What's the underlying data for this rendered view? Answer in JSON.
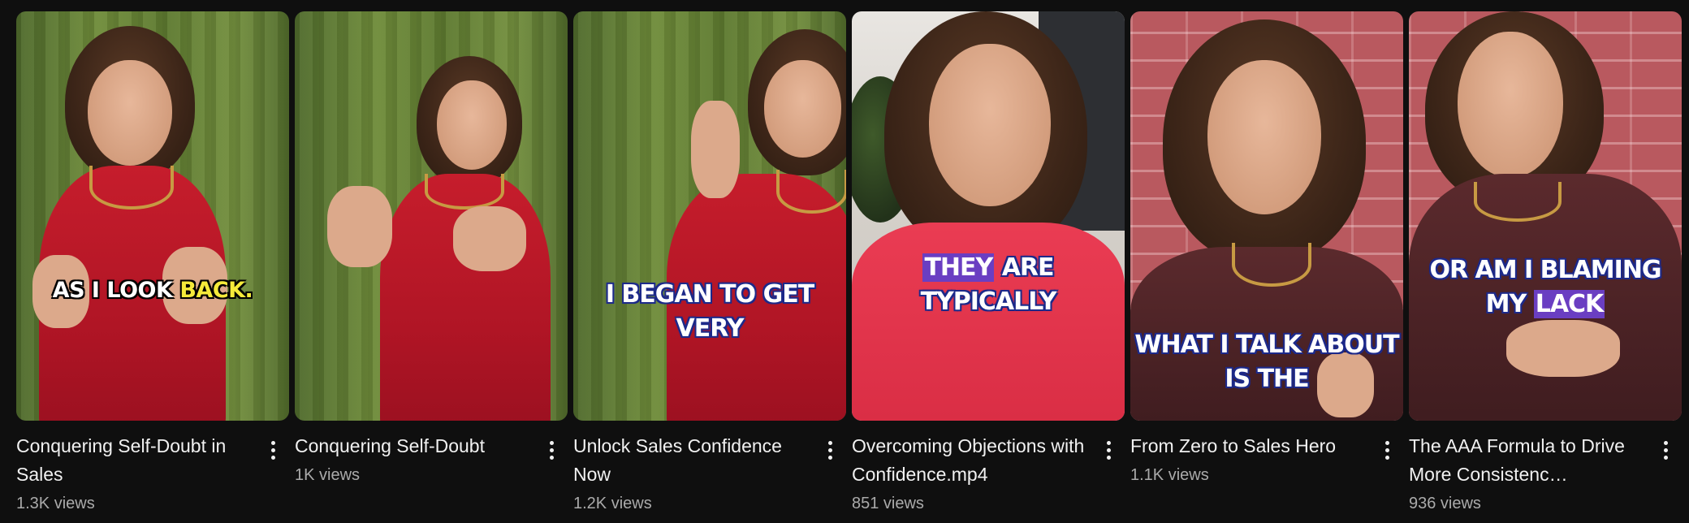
{
  "shorts": [
    {
      "title": "Conquering Self-Doubt in Sales",
      "views": "1.3K views",
      "caption_a": "AS I LOOK ",
      "caption_b": "BACK.",
      "menu_icon": "more-vert-icon"
    },
    {
      "title": "Conquering Self-Doubt",
      "views": "1K views",
      "menu_icon": "more-vert-icon"
    },
    {
      "title": "Unlock Sales Confidence Now",
      "views": "1.2K views",
      "caption_line1": "I BEGAN TO GET",
      "caption_line2": "VERY",
      "menu_icon": "more-vert-icon"
    },
    {
      "title": "Overcoming Objections with Confidence.mp4",
      "views": "851 views",
      "caption_hl": "THEY",
      "caption_rest": " ARE",
      "caption_line2": "TYPICALLY",
      "menu_icon": "more-vert-icon"
    },
    {
      "title": "From Zero to Sales Hero",
      "views": "1.1K views",
      "caption_line1": "WHAT I TALK ABOUT IS THE",
      "menu_icon": "more-vert-icon"
    },
    {
      "title": "The AAA Formula to Drive More Consistenc…",
      "views": "936 views",
      "caption_line1": "OR AM I BLAMING",
      "caption_pre": "MY ",
      "caption_hl": "LACK",
      "menu_icon": "more-vert-icon"
    }
  ],
  "colors": {
    "background": "#0f0f0f",
    "title": "#f1f1f1",
    "secondary_text": "#aaaaaa",
    "caption_yellow": "#f5ea3a",
    "caption_highlight": "#6a3ec2"
  }
}
